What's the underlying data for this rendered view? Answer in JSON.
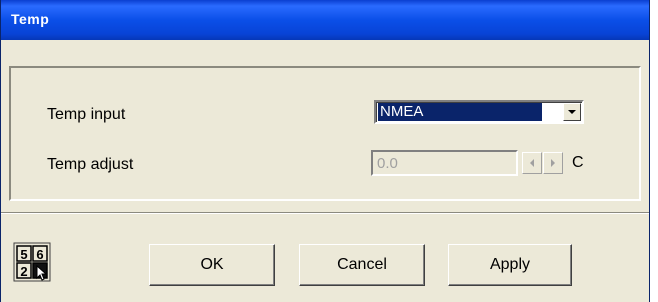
{
  "window": {
    "title": "Temp"
  },
  "form": {
    "temp_input_label": "Temp input",
    "temp_input_value": "NMEA",
    "temp_adjust_label": "Temp adjust",
    "temp_adjust_value": "0.0",
    "temp_adjust_unit": "C"
  },
  "buttons": {
    "ok": "OK",
    "cancel": "Cancel",
    "apply": "Apply"
  },
  "keypad_icon": {
    "digits": [
      "5",
      "6",
      "2",
      ""
    ],
    "name": "numeric-keypad-icon"
  },
  "colors": {
    "titlebar": "#0b4fe8",
    "selection": "#0a246a",
    "face": "#ece9d8"
  }
}
